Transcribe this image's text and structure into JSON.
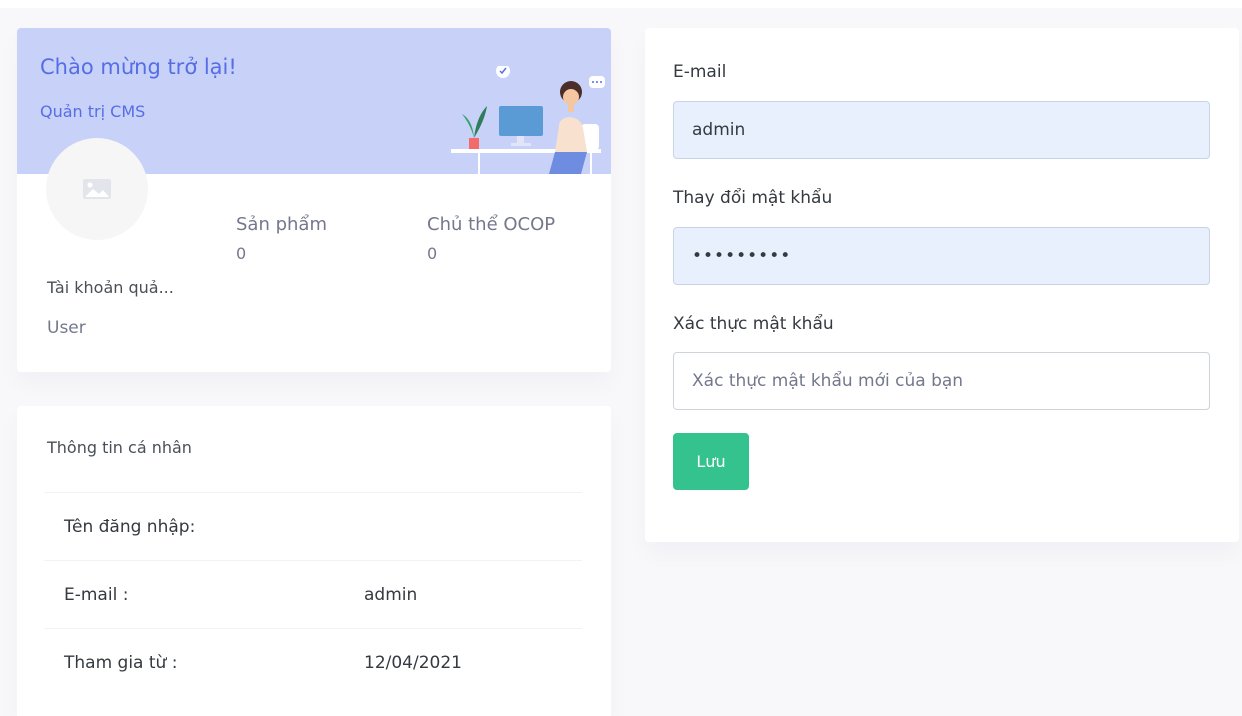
{
  "profile": {
    "welcome_title": "Chào mừng trở lại!",
    "welcome_subtitle": "Quản trị CMS",
    "account_name": "Tài khoản quả...",
    "account_role": "User",
    "stats": [
      {
        "label": "Sản phẩm",
        "value": "0"
      },
      {
        "label": "Chủ thể OCOP",
        "value": "0"
      }
    ]
  },
  "info": {
    "title": "Thông tin cá nhân",
    "rows": [
      {
        "label": "Tên đăng nhập:",
        "value": ""
      },
      {
        "label": "E-mail :",
        "value": "admin"
      },
      {
        "label": "Tham gia từ :",
        "value": "12/04/2021"
      }
    ]
  },
  "form": {
    "email_label": "E-mail",
    "email_value": "admin",
    "password_label": "Thay đổi mật khẩu",
    "password_value": "•••••••••",
    "confirm_label": "Xác thực mật khẩu",
    "confirm_placeholder": "Xác thực mật khẩu mới của bạn",
    "save_label": "Lưu"
  },
  "colors": {
    "primary": "#556ee6",
    "banner": "#c8d1f8",
    "success": "#34c38f",
    "autofill": "#e8f0fe"
  },
  "icons": [
    "image-placeholder-icon",
    "office-illustration"
  ]
}
